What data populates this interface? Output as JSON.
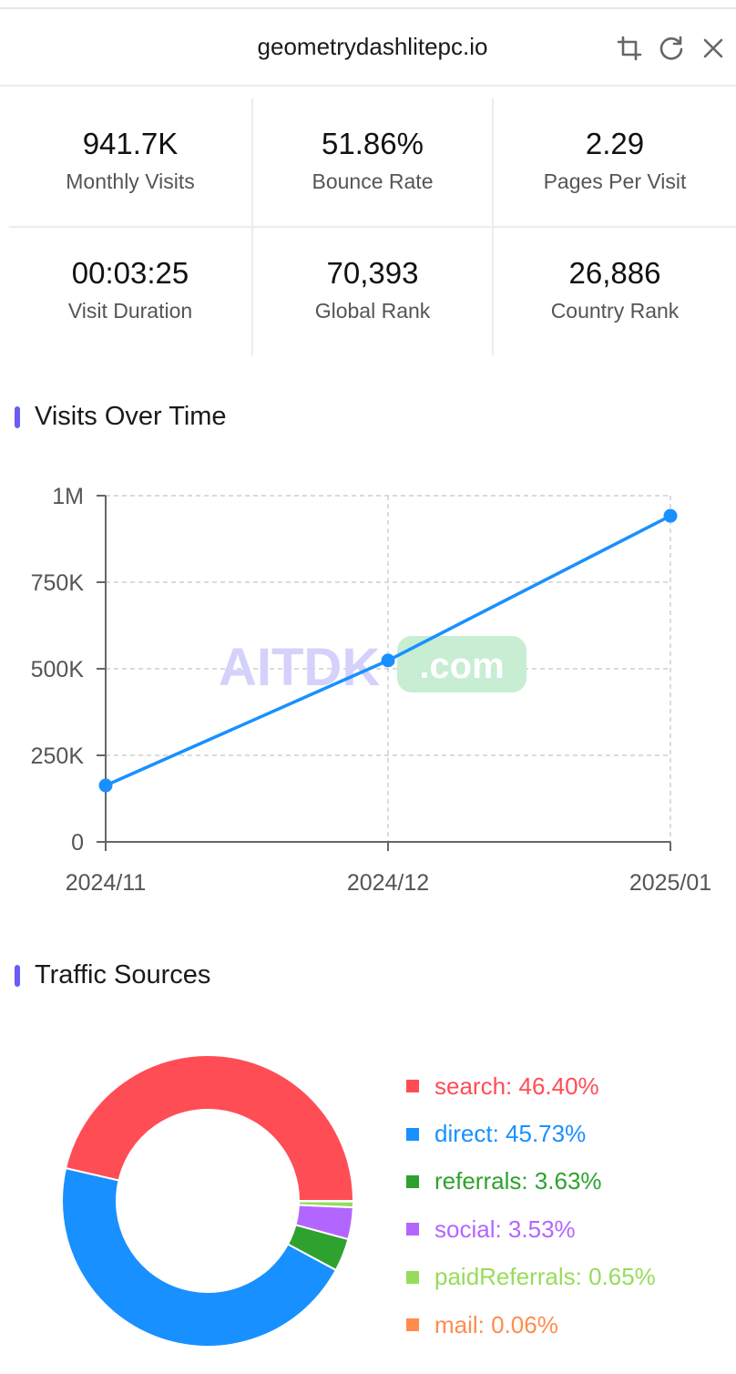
{
  "header": {
    "title": "geometrydashlitepc.io",
    "icons": [
      "crop-icon",
      "refresh-icon",
      "close-icon"
    ]
  },
  "stats": [
    {
      "value": "941.7K",
      "label": "Monthly Visits"
    },
    {
      "value": "51.86%",
      "label": "Bounce Rate"
    },
    {
      "value": "2.29",
      "label": "Pages Per Visit"
    },
    {
      "value": "00:03:25",
      "label": "Visit Duration"
    },
    {
      "value": "70,393",
      "label": "Global Rank"
    },
    {
      "value": "26,886",
      "label": "Country Rank"
    }
  ],
  "sections": {
    "visits_title": "Visits Over Time",
    "traffic_title": "Traffic Sources",
    "accent": "#6b5cf6"
  },
  "watermark": {
    "left": "AITDK",
    "right": ".com"
  },
  "chart_data": [
    {
      "type": "line",
      "title": "Visits Over Time",
      "x": [
        "2024/11",
        "2024/12",
        "2025/01"
      ],
      "y_ticks": [
        "0",
        "250K",
        "500K",
        "750K",
        "1M"
      ],
      "series": [
        {
          "values": [
            163000,
            524000,
            941700
          ],
          "color": "#1890ff"
        }
      ],
      "ylim": [
        0,
        1000000
      ],
      "grid": true
    },
    {
      "type": "pie",
      "title": "Traffic Sources",
      "donut": true,
      "slices": [
        {
          "name": "search",
          "value": 46.4,
          "label": "search: 46.40%",
          "color": "#ff4d55"
        },
        {
          "name": "direct",
          "value": 45.73,
          "label": "direct: 45.73%",
          "color": "#1890ff"
        },
        {
          "name": "referrals",
          "value": 3.63,
          "label": "referrals: 3.63%",
          "color": "#2fa12f"
        },
        {
          "name": "social",
          "value": 3.53,
          "label": "social: 3.53%",
          "color": "#b366ff"
        },
        {
          "name": "paidReferrals",
          "value": 0.65,
          "label": "paidReferrals: 0.65%",
          "color": "#97dc5a"
        },
        {
          "name": "mail",
          "value": 0.06,
          "label": "mail: 0.06%",
          "color": "#ff8c4d"
        }
      ]
    }
  ]
}
